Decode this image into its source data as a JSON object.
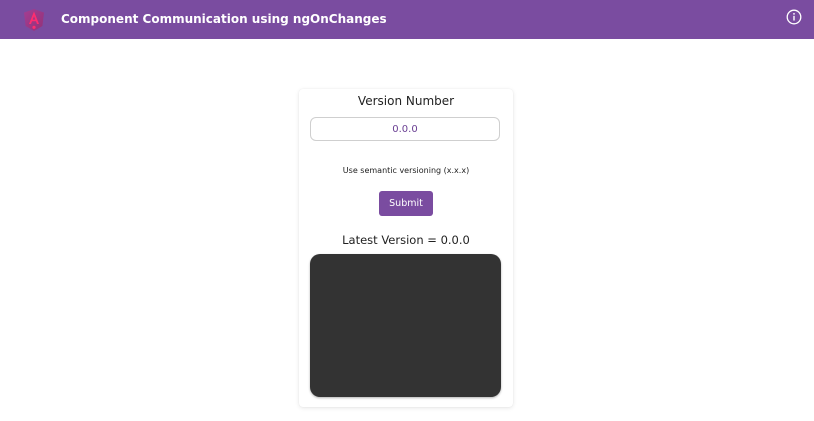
{
  "header": {
    "title": "Component Communication using ngOnChanges",
    "background": "#7a4ca0",
    "logo_icon": "angular-logo-icon",
    "info_icon": "info-icon"
  },
  "form": {
    "label": "Version Number",
    "input_value": "0.0.0",
    "hint": "Use semantic versioning (x.x.x)",
    "submit_label": "Submit",
    "accent": "#7a4ca0"
  },
  "output": {
    "latest_label": "Latest Version = ",
    "latest_value": "0.0.0",
    "panel_color": "#333333"
  }
}
